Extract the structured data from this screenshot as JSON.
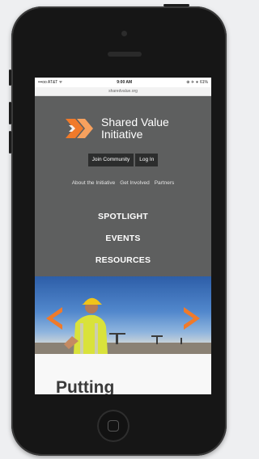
{
  "status_bar": {
    "carrier": "•••oo AT&T ᯤ",
    "time": "9:00 AM",
    "battery": "⊕ ✈ ∗ 61%"
  },
  "url_bar": {
    "url": "sharedvalue.org"
  },
  "logo": {
    "line1": "Shared Value",
    "line2": "Initiative"
  },
  "header_buttons": {
    "join": "Join Community",
    "login": "Log In"
  },
  "subnav": {
    "about": "About the Initiative",
    "involved": "Get Involved",
    "partners": "Partners"
  },
  "main_nav": {
    "spotlight": "SPOTLIGHT",
    "events": "EVENTS",
    "resources": "RESOURCES"
  },
  "content": {
    "heading": "Putting"
  },
  "colors": {
    "header_bg": "#5e5f5f",
    "button_bg": "#2c2d2d",
    "accent_orange": "#f07a2a",
    "phone_body": "#161616"
  },
  "icons": {
    "logo": "chevron-logo-icon",
    "carousel_prev": "chevron-left-icon",
    "carousel_next": "chevron-right-icon",
    "home": "home-button-icon"
  }
}
